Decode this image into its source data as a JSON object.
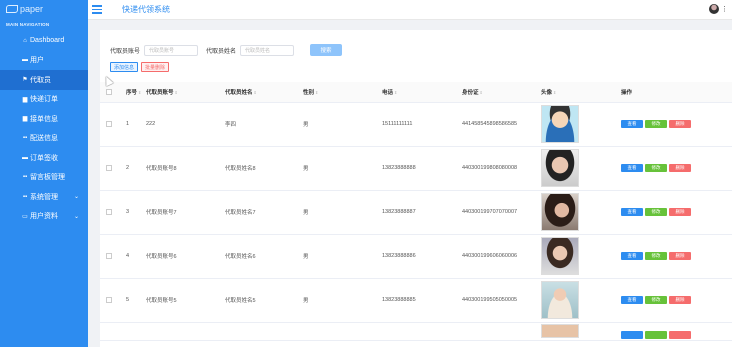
{
  "logo": {
    "text": "paper"
  },
  "nav": {
    "caption": "MAIN NAVIGATION",
    "items": [
      {
        "label": "Dashboard",
        "icon": "home-icon",
        "glyph": "⌂"
      },
      {
        "label": "用户",
        "icon": "user-icon",
        "glyph": "▬"
      },
      {
        "label": "代取员",
        "icon": "flag-icon",
        "glyph": "⚑"
      },
      {
        "label": "快递订单",
        "icon": "list-icon",
        "glyph": "▆"
      },
      {
        "label": "接单信息",
        "icon": "file-icon",
        "glyph": "▆"
      },
      {
        "label": "配送信息",
        "icon": "grid-icon",
        "glyph": "▪▪"
      },
      {
        "label": "订单签收",
        "icon": "card-icon",
        "glyph": "▬"
      },
      {
        "label": "留言板管理",
        "icon": "grid-icon",
        "glyph": "▪▪"
      },
      {
        "label": "系统管理",
        "icon": "grid-icon",
        "glyph": "▪▪"
      },
      {
        "label": "用户资料",
        "icon": "id-card-icon",
        "glyph": "▭"
      }
    ]
  },
  "header": {
    "title": "快递代领系统"
  },
  "search": {
    "label1": "代取员账号",
    "placeholder1": "代取员账号",
    "label2": "代取员姓名",
    "placeholder2": "代取员姓名",
    "button": "搜索"
  },
  "actions": {
    "add": "添加信息",
    "delete": "批量删除"
  },
  "table": {
    "headers": [
      "序号",
      "代取员账号",
      "代取员姓名",
      "性别",
      "电话",
      "身份证",
      "头像",
      "操作"
    ],
    "ops": {
      "view": "查看",
      "edit": "修改",
      "delete": "删除"
    },
    "rows": [
      {
        "no": "1",
        "account": "222",
        "name": "李四",
        "gender": "男",
        "phone": "15111111111",
        "id": "441458545898586585"
      },
      {
        "no": "2",
        "account": "代取员账号8",
        "name": "代取员姓名8",
        "gender": "男",
        "phone": "13823888888",
        "id": "440300199808080008"
      },
      {
        "no": "3",
        "account": "代取员账号7",
        "name": "代取员姓名7",
        "gender": "男",
        "phone": "13823888887",
        "id": "440300199707070007"
      },
      {
        "no": "4",
        "account": "代取员账号6",
        "name": "代取员姓名6",
        "gender": "男",
        "phone": "13823888886",
        "id": "440300199606060006"
      },
      {
        "no": "5",
        "account": "代取员账号5",
        "name": "代取员姓名5",
        "gender": "男",
        "phone": "13823888885",
        "id": "440300199505050005"
      }
    ]
  }
}
